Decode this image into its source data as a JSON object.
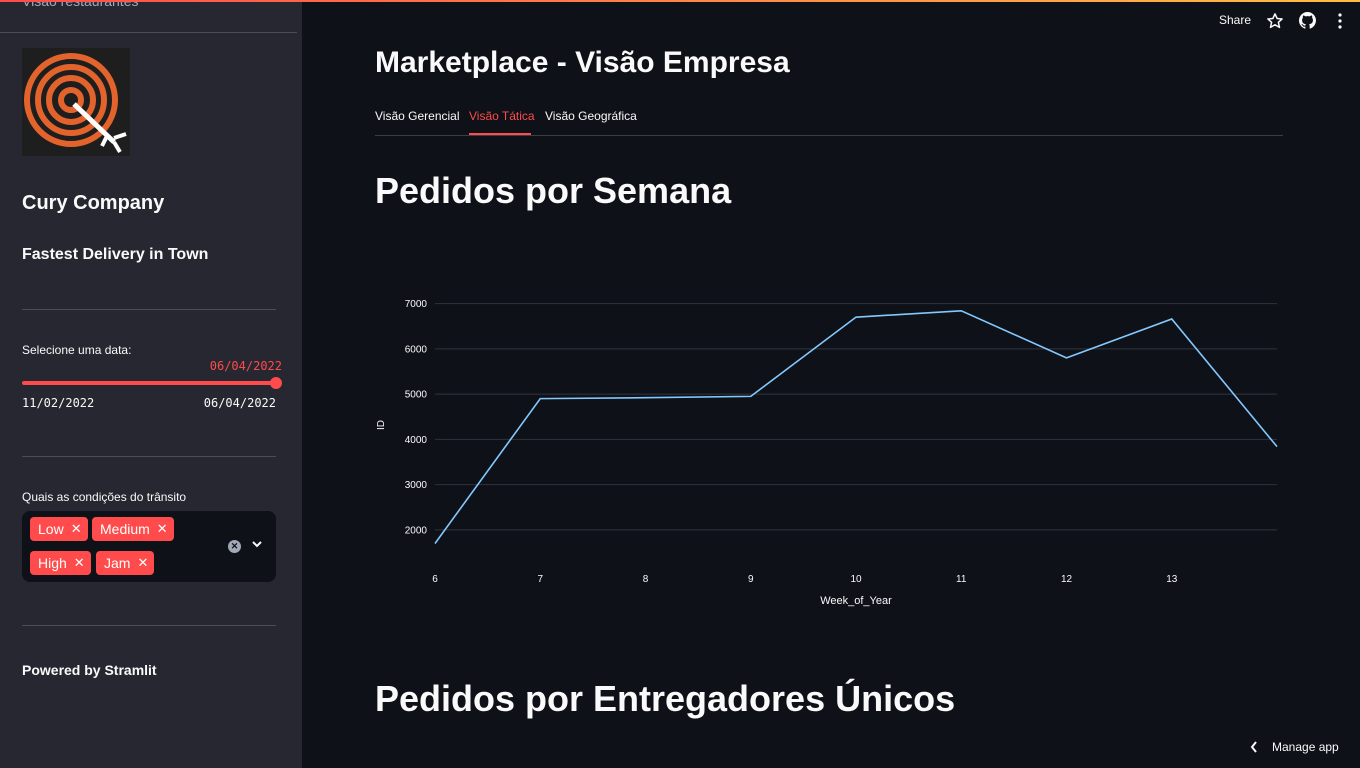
{
  "sidebar": {
    "nav_item": "Visão restaurantes",
    "company": "Cury Company",
    "tagline": "Fastest Delivery in Town",
    "date_label": "Selecione uma data:",
    "date_value": "06/04/2022",
    "date_min": "11/02/2022",
    "date_max": "06/04/2022",
    "slider_fraction": 1.0,
    "traffic_label": "Quais as condições do trânsito",
    "traffic_tags": [
      "Low",
      "Medium",
      "High",
      "Jam"
    ],
    "powered": "Powered by Stramlit"
  },
  "header": {
    "share": "Share"
  },
  "main": {
    "title": "Marketplace - Visão Empresa",
    "tabs": [
      "Visão Gerencial",
      "Visão Tática",
      "Visão Geográfica"
    ],
    "active_tab": 1,
    "section1": "Pedidos por Semana",
    "section2": "Pedidos por Entregadores Únicos"
  },
  "footer": {
    "manage": "Manage app"
  },
  "colors": {
    "accent": "#ff4b4b",
    "line": "#83c9ff",
    "sidebar_bg": "#262730",
    "bg": "#0e1117"
  },
  "chart_data": {
    "type": "line",
    "x": [
      6,
      7,
      8,
      9,
      10,
      11,
      12,
      13,
      14
    ],
    "y": [
      1700,
      4900,
      4920,
      4950,
      6700,
      6840,
      5800,
      6660,
      3840
    ],
    "xticks": [
      6,
      7,
      8,
      9,
      10,
      11,
      12,
      13
    ],
    "yticks": [
      2000,
      3000,
      4000,
      5000,
      6000,
      7000
    ],
    "xlabel": "Week_of_Year",
    "ylabel": "ID",
    "xlim": [
      6,
      14
    ],
    "grid": true
  }
}
